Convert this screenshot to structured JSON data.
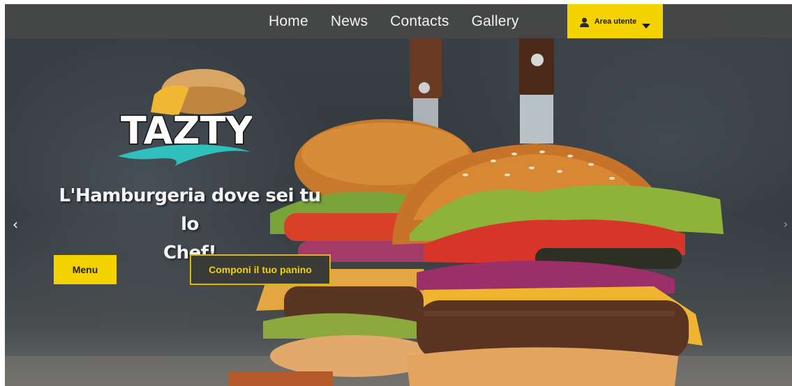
{
  "nav": {
    "links": [
      {
        "label": "Home"
      },
      {
        "label": "News"
      },
      {
        "label": "Contacts"
      },
      {
        "label": "Gallery"
      }
    ],
    "user_area": {
      "label": "Area utente",
      "icon": "user-icon",
      "dropdown_icon": "caret-down-icon"
    }
  },
  "hero": {
    "logo_text": "TAZTY",
    "headline_line1": "L'Hamburgeria dove sei tu lo",
    "headline_line2": "Chef!",
    "primary_button": "Menu",
    "secondary_button": "Componi il tuo panino",
    "prev_arrow": "‹",
    "next_arrow": "›"
  },
  "colors": {
    "accent": "#f5d300",
    "nav_bg": "#464646",
    "secondary_button_bg": "#3a3a38",
    "text_light": "#f4f4f4"
  }
}
